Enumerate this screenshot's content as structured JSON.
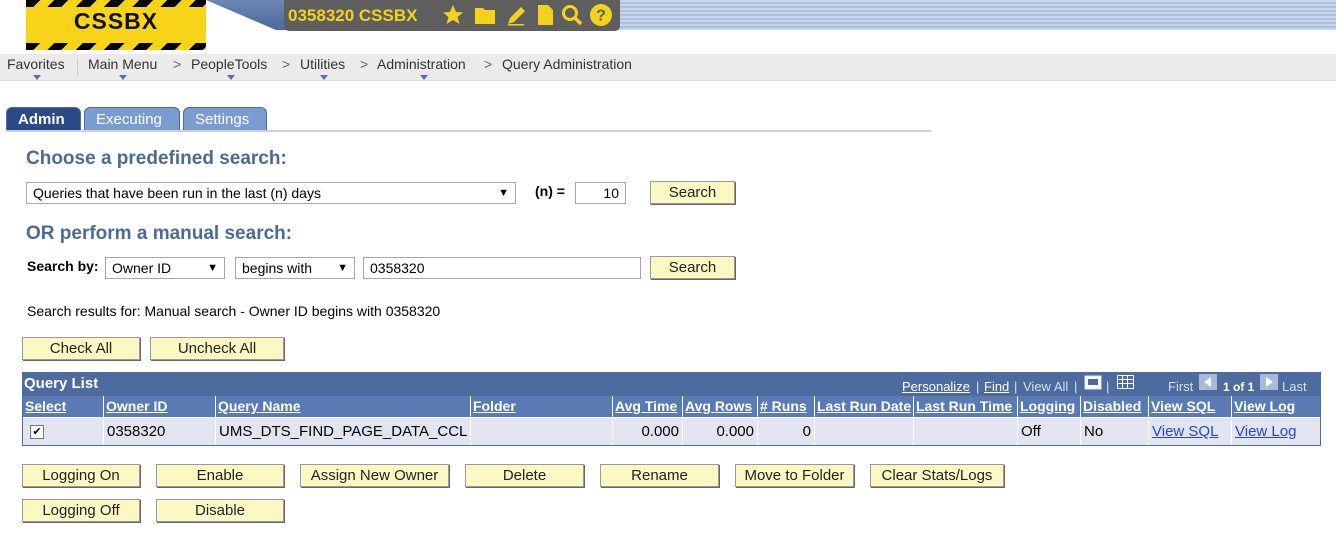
{
  "header": {
    "logo_text": "CSSBX",
    "environment": "0358320 CSSBX",
    "icons": [
      "star-icon",
      "folder-icon",
      "pencil-icon",
      "document-icon",
      "search-icon",
      "help-icon"
    ]
  },
  "breadcrumb": {
    "items": [
      "Favorites",
      "Main Menu",
      "PeopleTools",
      "Utilities",
      "Administration",
      "Query Administration"
    ],
    "separator": ">"
  },
  "tabs": [
    "Admin",
    "Executing",
    "Settings"
  ],
  "predefined": {
    "heading": "Choose a predefined search:",
    "selected": "Queries that have been run in the last (n) days",
    "n_label": "(n) =",
    "n_value": "10",
    "search_label": "Search"
  },
  "manual": {
    "heading": "OR perform a manual search:",
    "search_by_label": "Search by:",
    "field": "Owner ID",
    "operator": "begins with",
    "value": "0358320",
    "search_label": "Search"
  },
  "results_text": "Search results for: Manual search - Owner ID begins with 0358320",
  "check_all": "Check All",
  "uncheck_all": "Uncheck All",
  "grid": {
    "title": "Query List",
    "personalize": "Personalize",
    "find": "Find",
    "view_all": "View All",
    "first": "First",
    "range": "1 of 1",
    "last": "Last",
    "columns": [
      "Select",
      "Owner ID",
      "Query Name",
      "Folder",
      "Avg Time",
      "Avg Rows",
      "# Runs",
      "Last Run Date",
      "Last Run Time",
      "Logging",
      "Disabled",
      "View SQL",
      "View Log"
    ],
    "rows": [
      {
        "select": "✔",
        "owner_id": "0358320",
        "query_name": "UMS_DTS_FIND_PAGE_DATA_CCL",
        "folder": "",
        "avg_time": "0.000",
        "avg_rows": "0.000",
        "runs": "0",
        "last_run_date": "",
        "last_run_time": "",
        "logging": "Off",
        "disabled": "No",
        "view_sql": "View SQL",
        "view_log": "View Log"
      }
    ]
  },
  "actions": [
    "Logging On",
    "Enable",
    "Assign New Owner",
    "Delete",
    "Rename",
    "Move to Folder",
    "Clear Stats/Logs",
    "Logging Off",
    "Disable"
  ],
  "colors": {
    "accent": "#4e6b9f",
    "heading": "#4c6a96",
    "button_bg": "#fcf8c4",
    "logo_yellow": "#f7d417"
  }
}
